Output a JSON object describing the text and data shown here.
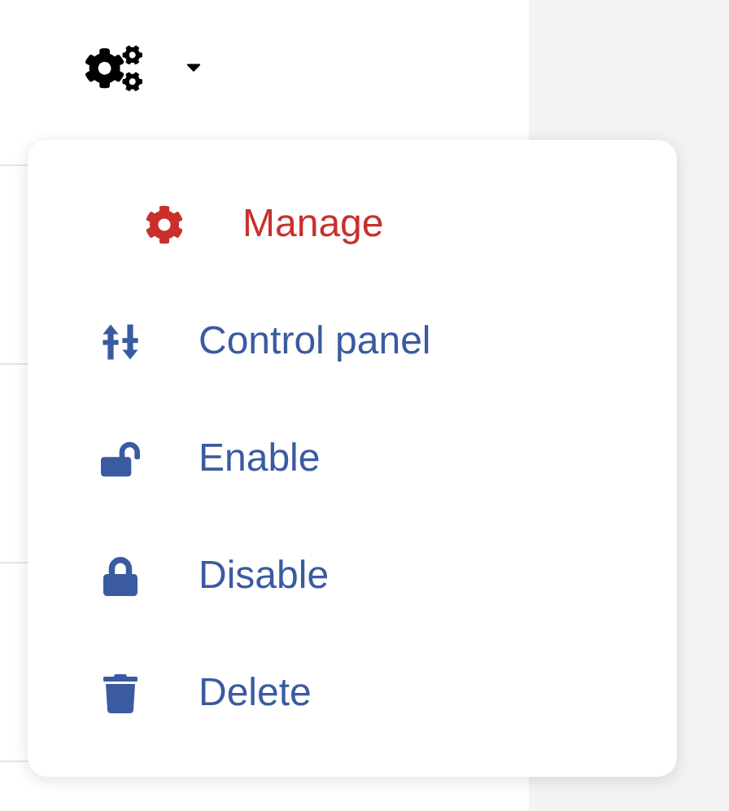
{
  "menu": {
    "items": [
      {
        "label": "Manage",
        "kind": "gear",
        "selected": true
      },
      {
        "label": "Control panel",
        "kind": "sliders",
        "selected": false
      },
      {
        "label": "Enable",
        "kind": "unlock",
        "selected": false
      },
      {
        "label": "Disable",
        "kind": "lock",
        "selected": false
      },
      {
        "label": "Delete",
        "kind": "trash",
        "selected": false
      }
    ]
  }
}
